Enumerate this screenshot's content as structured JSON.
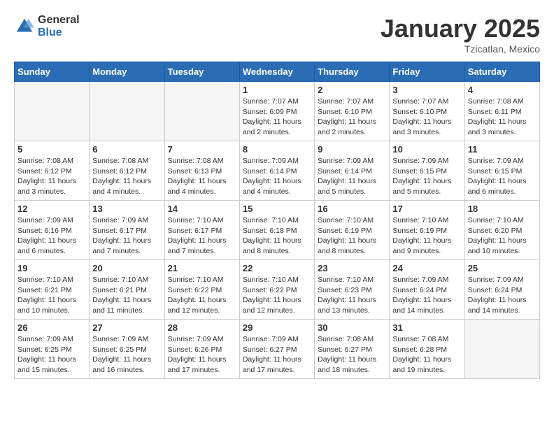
{
  "header": {
    "logo_general": "General",
    "logo_blue": "Blue",
    "month_title": "January 2025",
    "location": "Tzicatlan, Mexico"
  },
  "days_of_week": [
    "Sunday",
    "Monday",
    "Tuesday",
    "Wednesday",
    "Thursday",
    "Friday",
    "Saturday"
  ],
  "weeks": [
    [
      {
        "day": "",
        "info": ""
      },
      {
        "day": "",
        "info": ""
      },
      {
        "day": "",
        "info": ""
      },
      {
        "day": "1",
        "info": "Sunrise: 7:07 AM\nSunset: 6:09 PM\nDaylight: 11 hours\nand 2 minutes."
      },
      {
        "day": "2",
        "info": "Sunrise: 7:07 AM\nSunset: 6:10 PM\nDaylight: 11 hours\nand 2 minutes."
      },
      {
        "day": "3",
        "info": "Sunrise: 7:07 AM\nSunset: 6:10 PM\nDaylight: 11 hours\nand 3 minutes."
      },
      {
        "day": "4",
        "info": "Sunrise: 7:08 AM\nSunset: 6:11 PM\nDaylight: 11 hours\nand 3 minutes."
      }
    ],
    [
      {
        "day": "5",
        "info": "Sunrise: 7:08 AM\nSunset: 6:12 PM\nDaylight: 11 hours\nand 3 minutes."
      },
      {
        "day": "6",
        "info": "Sunrise: 7:08 AM\nSunset: 6:12 PM\nDaylight: 11 hours\nand 4 minutes."
      },
      {
        "day": "7",
        "info": "Sunrise: 7:08 AM\nSunset: 6:13 PM\nDaylight: 11 hours\nand 4 minutes."
      },
      {
        "day": "8",
        "info": "Sunrise: 7:09 AM\nSunset: 6:14 PM\nDaylight: 11 hours\nand 4 minutes."
      },
      {
        "day": "9",
        "info": "Sunrise: 7:09 AM\nSunset: 6:14 PM\nDaylight: 11 hours\nand 5 minutes."
      },
      {
        "day": "10",
        "info": "Sunrise: 7:09 AM\nSunset: 6:15 PM\nDaylight: 11 hours\nand 5 minutes."
      },
      {
        "day": "11",
        "info": "Sunrise: 7:09 AM\nSunset: 6:15 PM\nDaylight: 11 hours\nand 6 minutes."
      }
    ],
    [
      {
        "day": "12",
        "info": "Sunrise: 7:09 AM\nSunset: 6:16 PM\nDaylight: 11 hours\nand 6 minutes."
      },
      {
        "day": "13",
        "info": "Sunrise: 7:09 AM\nSunset: 6:17 PM\nDaylight: 11 hours\nand 7 minutes."
      },
      {
        "day": "14",
        "info": "Sunrise: 7:10 AM\nSunset: 6:17 PM\nDaylight: 11 hours\nand 7 minutes."
      },
      {
        "day": "15",
        "info": "Sunrise: 7:10 AM\nSunset: 6:18 PM\nDaylight: 11 hours\nand 8 minutes."
      },
      {
        "day": "16",
        "info": "Sunrise: 7:10 AM\nSunset: 6:19 PM\nDaylight: 11 hours\nand 8 minutes."
      },
      {
        "day": "17",
        "info": "Sunrise: 7:10 AM\nSunset: 6:19 PM\nDaylight: 11 hours\nand 9 minutes."
      },
      {
        "day": "18",
        "info": "Sunrise: 7:10 AM\nSunset: 6:20 PM\nDaylight: 11 hours\nand 10 minutes."
      }
    ],
    [
      {
        "day": "19",
        "info": "Sunrise: 7:10 AM\nSunset: 6:21 PM\nDaylight: 11 hours\nand 10 minutes."
      },
      {
        "day": "20",
        "info": "Sunrise: 7:10 AM\nSunset: 6:21 PM\nDaylight: 11 hours\nand 11 minutes."
      },
      {
        "day": "21",
        "info": "Sunrise: 7:10 AM\nSunset: 6:22 PM\nDaylight: 11 hours\nand 12 minutes."
      },
      {
        "day": "22",
        "info": "Sunrise: 7:10 AM\nSunset: 6:22 PM\nDaylight: 11 hours\nand 12 minutes."
      },
      {
        "day": "23",
        "info": "Sunrise: 7:10 AM\nSunset: 6:23 PM\nDaylight: 11 hours\nand 13 minutes."
      },
      {
        "day": "24",
        "info": "Sunrise: 7:09 AM\nSunset: 6:24 PM\nDaylight: 11 hours\nand 14 minutes."
      },
      {
        "day": "25",
        "info": "Sunrise: 7:09 AM\nSunset: 6:24 PM\nDaylight: 11 hours\nand 14 minutes."
      }
    ],
    [
      {
        "day": "26",
        "info": "Sunrise: 7:09 AM\nSunset: 6:25 PM\nDaylight: 11 hours\nand 15 minutes."
      },
      {
        "day": "27",
        "info": "Sunrise: 7:09 AM\nSunset: 6:25 PM\nDaylight: 11 hours\nand 16 minutes."
      },
      {
        "day": "28",
        "info": "Sunrise: 7:09 AM\nSunset: 6:26 PM\nDaylight: 11 hours\nand 17 minutes."
      },
      {
        "day": "29",
        "info": "Sunrise: 7:09 AM\nSunset: 6:27 PM\nDaylight: 11 hours\nand 17 minutes."
      },
      {
        "day": "30",
        "info": "Sunrise: 7:08 AM\nSunset: 6:27 PM\nDaylight: 11 hours\nand 18 minutes."
      },
      {
        "day": "31",
        "info": "Sunrise: 7:08 AM\nSunset: 6:28 PM\nDaylight: 11 hours\nand 19 minutes."
      },
      {
        "day": "",
        "info": ""
      }
    ]
  ]
}
